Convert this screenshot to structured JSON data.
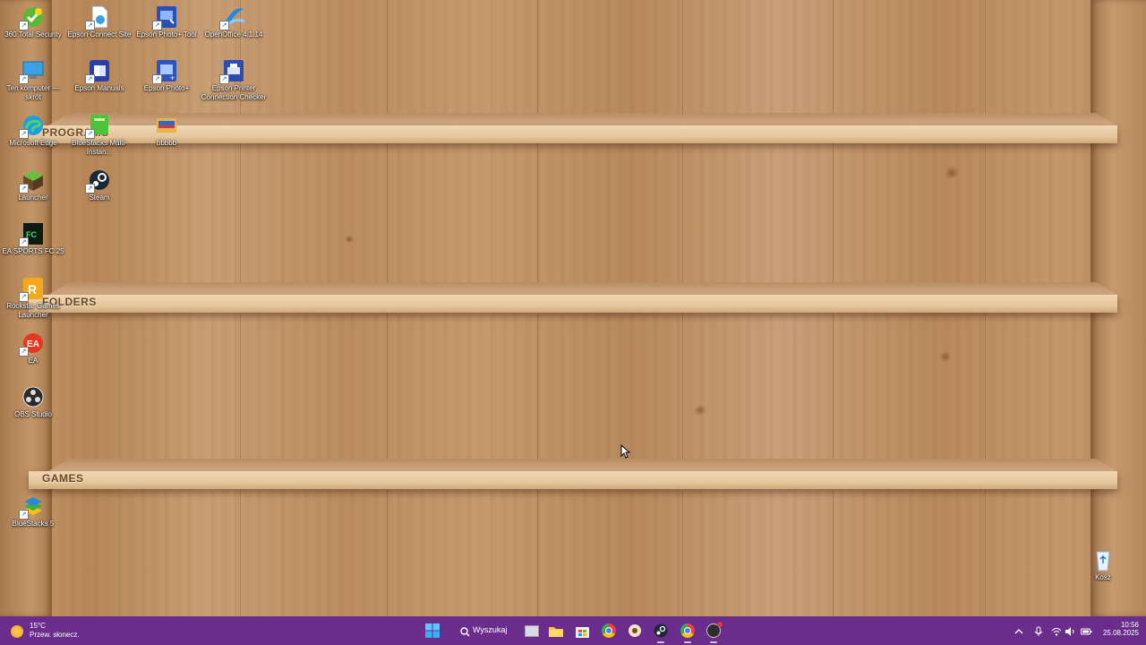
{
  "desktop": {
    "shelves": [
      "PROGRAMS",
      "FOLDERS",
      "GAMES"
    ],
    "icons": [
      {
        "label": "360 Total Security",
        "icon": "360-security-icon",
        "color": "#5cb832"
      },
      {
        "label": "Epson Connect Site",
        "icon": "document-globe-icon",
        "color": "#ffffff"
      },
      {
        "label": "Epson Photo+ Tool",
        "icon": "epson-photo-tool-icon",
        "color": "#2a4fb8"
      },
      {
        "label": "OpenOffice 4.1.14",
        "icon": "openoffice-icon",
        "color": "#1e88e5"
      },
      {
        "label": "Ten komputer — skrót",
        "icon": "computer-icon",
        "color": "#3aa0e0"
      },
      {
        "label": "Epson Manuals",
        "icon": "epson-manuals-icon",
        "color": "#2b3fa8"
      },
      {
        "label": "Epson Photo+",
        "icon": "epson-photo-icon",
        "color": "#2c53c0"
      },
      {
        "label": "Epson Printer Connection Checker",
        "icon": "printer-checker-icon",
        "color": "#2b4db0"
      },
      {
        "label": "Microsoft Edge",
        "icon": "edge-icon",
        "color": "#1fa0d8"
      },
      {
        "label": "BlueStacks Multi-Instan...",
        "icon": "bluestacks-multi-icon",
        "color": "#4dc23b"
      },
      {
        "label": "bbbbb",
        "icon": "folder-image-icon",
        "color": "#e8b44a"
      },
      {
        "label": "Launcher",
        "icon": "minecraft-launcher-icon",
        "color": "#4a8a2e"
      },
      {
        "label": "Steam",
        "icon": "steam-icon",
        "color": "#1b2838"
      },
      {
        "label": "EA SPORTS FC 25",
        "icon": "ea-fc-icon",
        "color": "#0f1a12"
      },
      {
        "label": "Rockstar Games Launcher",
        "icon": "rockstar-icon",
        "color": "#f4a81c"
      },
      {
        "label": "EA",
        "icon": "ea-icon",
        "color": "#e23a1f"
      },
      {
        "label": "OBS Studio",
        "icon": "obs-icon",
        "color": "#2b2b2b"
      },
      {
        "label": "BlueStacks 5",
        "icon": "bluestacks-icon",
        "color": "#3fae3a"
      },
      {
        "label": "Kosz",
        "icon": "recycle-bin-icon",
        "color": "#e8f2fb"
      }
    ]
  },
  "taskbar": {
    "weather": {
      "temp": "15°C",
      "desc": "Przew. słonecz.",
      "icon": "sun-icon"
    },
    "search_label": "Wyszukaj",
    "apps": [
      "start-icon",
      "task-view-icon",
      "file-explorer-icon",
      "store-icon",
      "chrome-icon",
      "media-player-icon",
      "steam-icon",
      "chrome-profile-icon",
      "app-notification-icon"
    ],
    "tray": [
      "chevron-up-icon",
      "microphone-icon",
      "wifi-icon",
      "volume-icon",
      "battery-icon"
    ],
    "time": "10:56",
    "date": "25.08.2025",
    "accent": "#6a2d8c"
  }
}
